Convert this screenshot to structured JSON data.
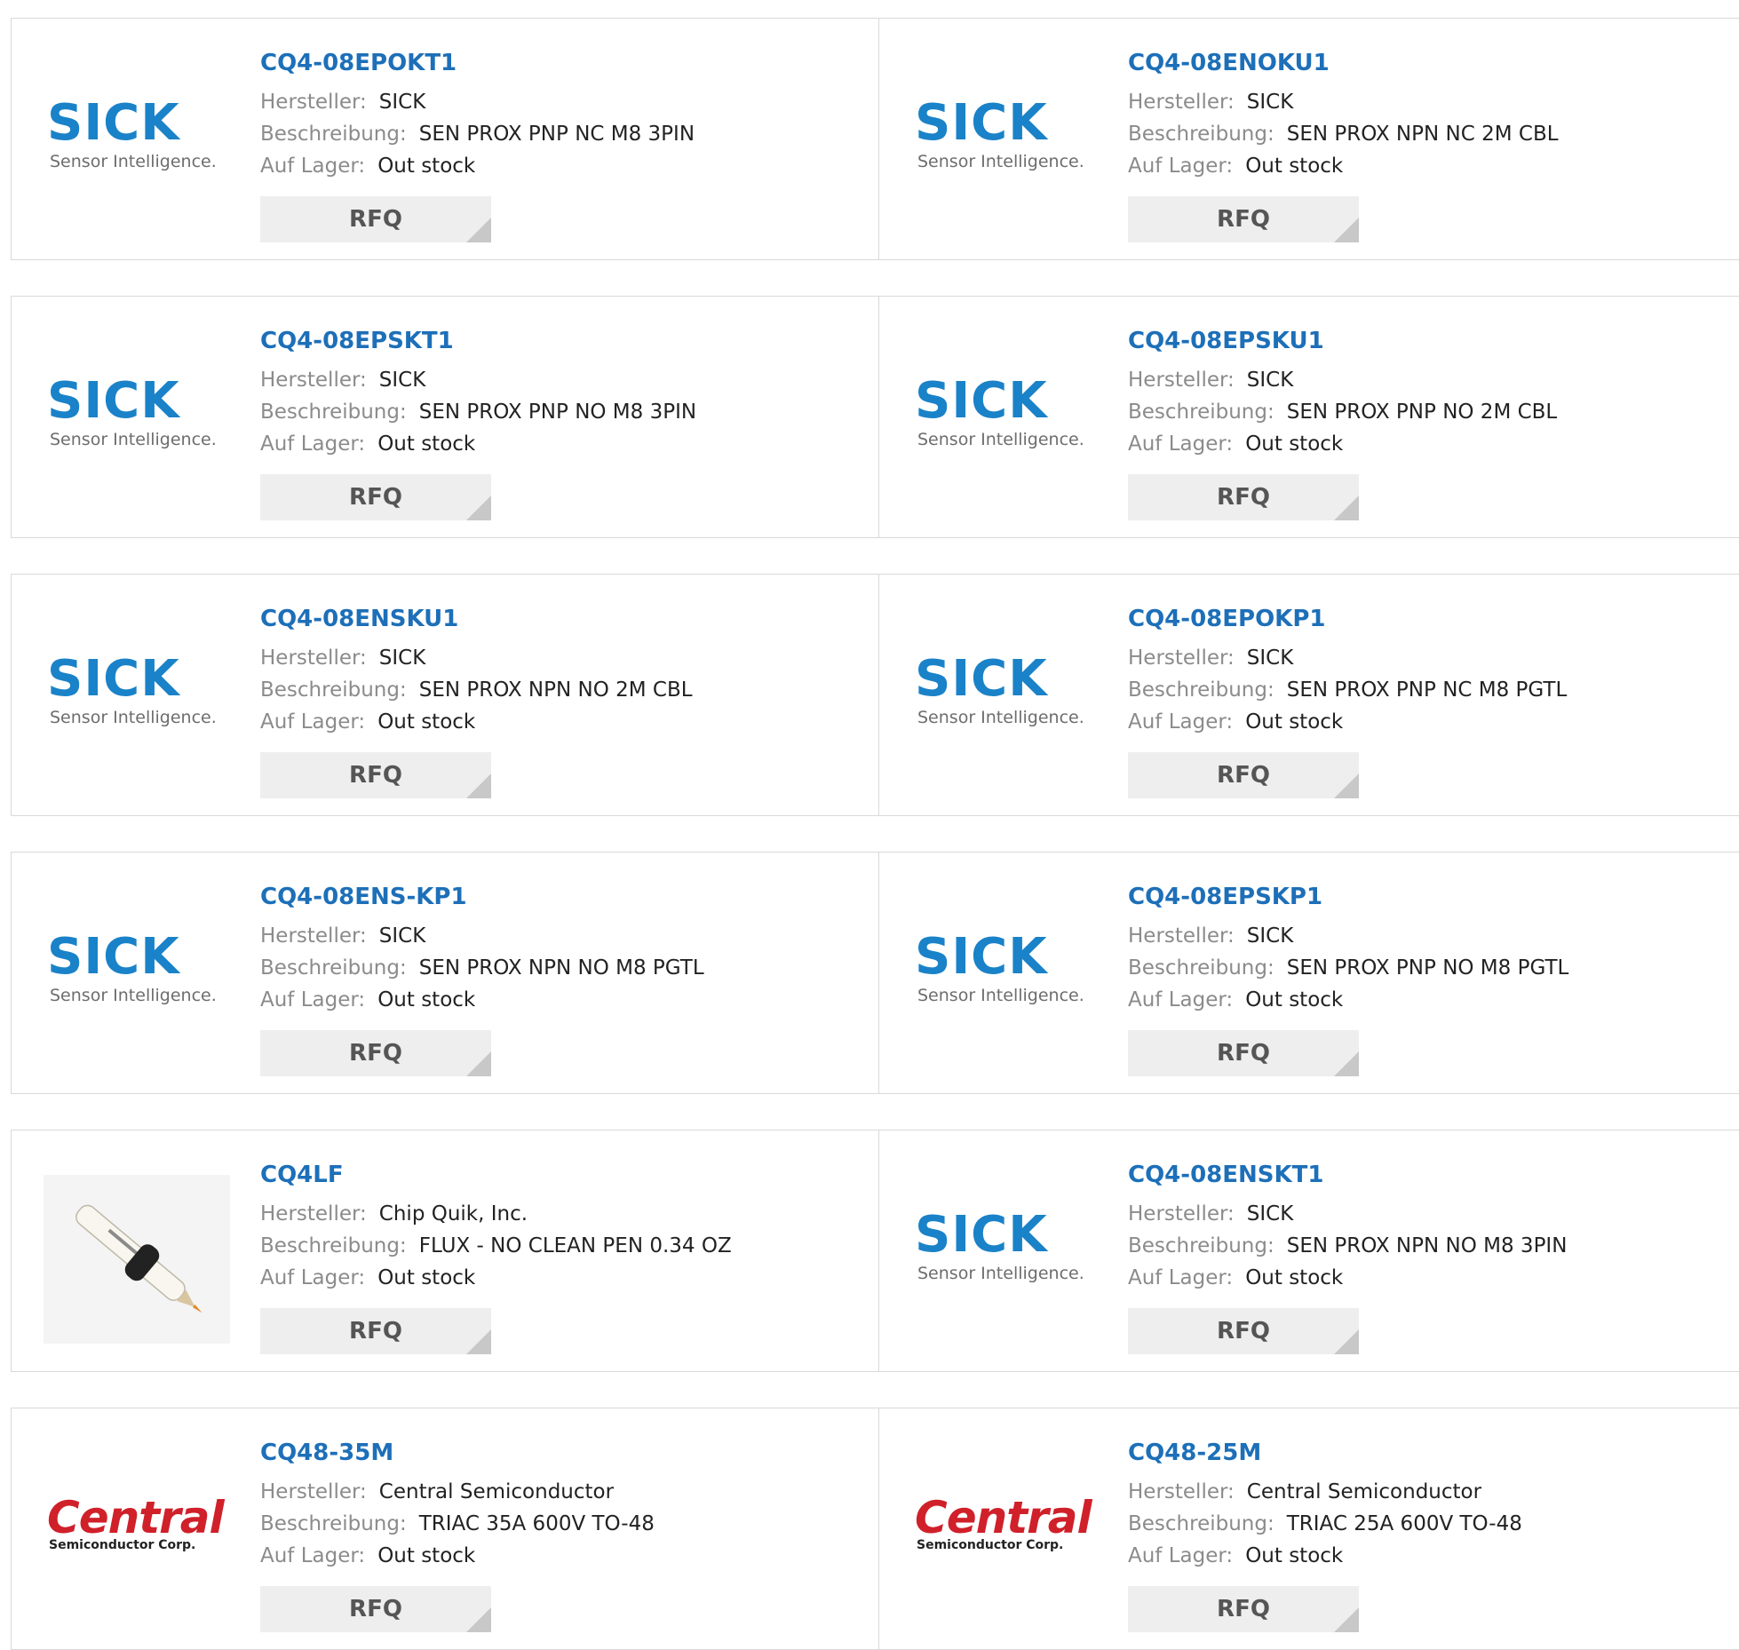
{
  "labels": {
    "manufacturer": "Hersteller:",
    "description": "Beschreibung:",
    "stock": "Auf Lager:",
    "rfq": "RFQ"
  },
  "logos": {
    "sick_word": "SICK",
    "sick_tag": "Sensor Intelligence.",
    "central_word": "Central",
    "central_tag": "Semiconductor Corp."
  },
  "products": [
    {
      "part": "CQ4-08EPOKT1",
      "manufacturer": "SICK",
      "description": "SEN PROX PNP NC M8 3PIN",
      "stock": "Out stock",
      "logo": "sick"
    },
    {
      "part": "CQ4-08ENOKU1",
      "manufacturer": "SICK",
      "description": "SEN PROX NPN NC 2M CBL",
      "stock": "Out stock",
      "logo": "sick"
    },
    {
      "part": "CQ4-08EPSKT1",
      "manufacturer": "SICK",
      "description": "SEN PROX PNP NO M8 3PIN",
      "stock": "Out stock",
      "logo": "sick"
    },
    {
      "part": "CQ4-08EPSKU1",
      "manufacturer": "SICK",
      "description": "SEN PROX PNP NO 2M CBL",
      "stock": "Out stock",
      "logo": "sick"
    },
    {
      "part": "CQ4-08ENSKU1",
      "manufacturer": "SICK",
      "description": "SEN PROX NPN NO 2M CBL",
      "stock": "Out stock",
      "logo": "sick"
    },
    {
      "part": "CQ4-08EPOKP1",
      "manufacturer": "SICK",
      "description": "SEN PROX PNP NC M8 PGTL",
      "stock": "Out stock",
      "logo": "sick"
    },
    {
      "part": "CQ4-08ENS-KP1",
      "manufacturer": "SICK",
      "description": "SEN PROX NPN NO M8 PGTL",
      "stock": "Out stock",
      "logo": "sick"
    },
    {
      "part": "CQ4-08EPSKP1",
      "manufacturer": "SICK",
      "description": "SEN PROX PNP NO M8 PGTL",
      "stock": "Out stock",
      "logo": "sick"
    },
    {
      "part": "CQ4LF",
      "manufacturer": "Chip Quik, Inc.",
      "description": "FLUX - NO CLEAN PEN 0.34 OZ",
      "stock": "Out stock",
      "logo": "pen"
    },
    {
      "part": "CQ4-08ENSKT1",
      "manufacturer": "SICK",
      "description": "SEN PROX NPN NO M8 3PIN",
      "stock": "Out stock",
      "logo": "sick"
    },
    {
      "part": "CQ48-35M",
      "manufacturer": "Central Semiconductor",
      "description": "TRIAC 35A 600V TO-48",
      "stock": "Out stock",
      "logo": "central"
    },
    {
      "part": "CQ48-25M",
      "manufacturer": "Central Semiconductor",
      "description": "TRIAC 25A 600V TO-48",
      "stock": "Out stock",
      "logo": "central"
    }
  ]
}
